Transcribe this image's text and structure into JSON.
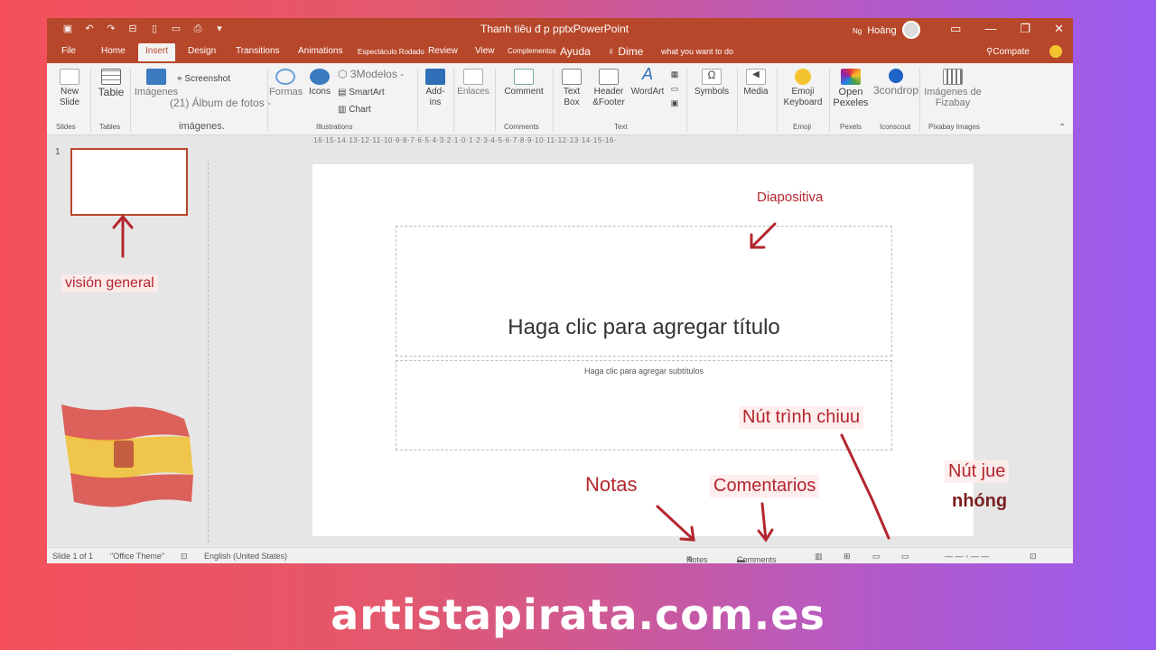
{
  "window": {
    "title": "Thanh tiêu đ p pptxPowerPoint",
    "user_name": "Hoàng",
    "user_prefix": "Ng"
  },
  "tabs": [
    {
      "label": "File"
    },
    {
      "label": "Home"
    },
    {
      "label": "Insert"
    },
    {
      "label": "Design"
    },
    {
      "label": "Transitions"
    },
    {
      "label": "Animations"
    },
    {
      "label": "Espectáculo Rodado"
    },
    {
      "label": "Review"
    },
    {
      "label": "View"
    },
    {
      "label": "Complementos"
    },
    {
      "label": "Ayuda"
    },
    {
      "label": "Dime"
    },
    {
      "label": "what you want to do"
    }
  ],
  "share_label": "Compate",
  "ribbon": {
    "new_slide": "New Slide",
    "table": "Tabie",
    "images": "Imágenes",
    "screenshot": "Screenshot",
    "album": "(21) Álbum de fotos -",
    "imagenes_group": "imágenes.",
    "formas": "Formas",
    "icons": "Icons",
    "modelos": "3Modelos -",
    "smartart": "SmartArt",
    "chart": "Chart",
    "addins": "Add-ins",
    "enlaces": "Enlaces",
    "comment": "Comment",
    "textbox": "Text Box",
    "header_footer": "Header &Footer",
    "wordart": "WordArt",
    "symbols": "Symbols",
    "media": "Media",
    "emoji": "Emoji Keyboard",
    "open_pexels": "Open Pexeles",
    "iconscout": "3condrop",
    "pixabay": "Imágenes de Fizabay"
  },
  "groups": {
    "slides": "Slides",
    "tables": "Tables",
    "illustrations": "Illustrations",
    "comments": "Comments",
    "text": "Text",
    "emoji": "Emoji",
    "pexels": "Pexels",
    "iconscout": "Iconscout",
    "pixabay": "Pixabay Images"
  },
  "hruler_text": "·16·15·14·13·12·11·10·9·8·7·6·5·4·3·2·1·0·1·2·3·4·5·6·7·8·9·10·11·12·13·14·15·16·",
  "thumbnail_number": "1",
  "slide": {
    "title_placeholder": "Haga clic para agregar título",
    "subtitle_placeholder": "Haga clic para agregar subtítulos"
  },
  "status": {
    "slide_count": "Slide 1 of 1",
    "theme": "\"Office Theme\"",
    "language": "English (United States)",
    "notes": "Notes",
    "comments": "Comments"
  },
  "annotations": {
    "diapositiva": "Diapositiva",
    "vision_general": "visión general",
    "nut_trinh_chieu": "Nút trình chiuu",
    "nut_jue": "Nút jue",
    "nhong": "nhóng",
    "notas": "Notas",
    "comentarios": "Comentarios"
  },
  "watermark": "artistapirata.com.es",
  "colors": {
    "accent": "#b7472a",
    "annotation": "#b3262e"
  }
}
